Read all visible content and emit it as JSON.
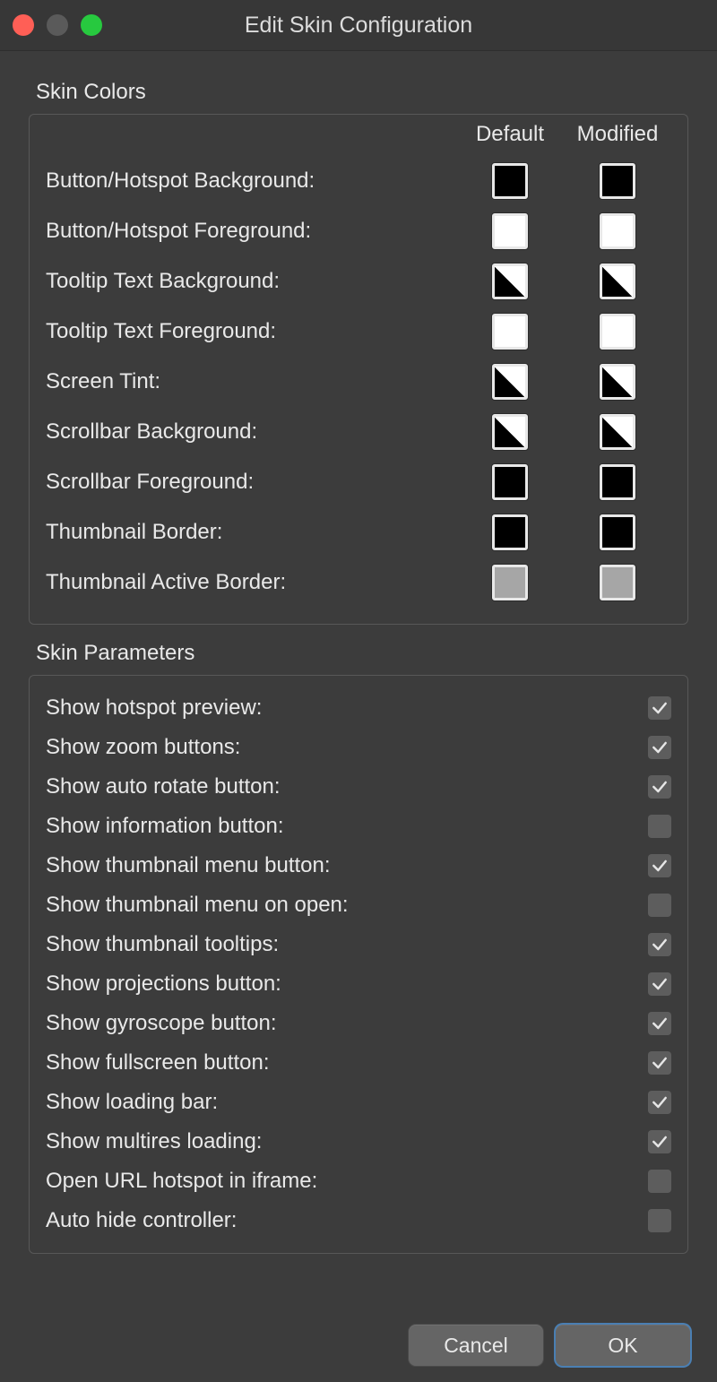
{
  "window": {
    "title": "Edit Skin Configuration"
  },
  "sections": {
    "colors_title": "Skin Colors",
    "params_title": "Skin Parameters"
  },
  "colors": {
    "header_default": "Default",
    "header_modified": "Modified",
    "rows": [
      {
        "label": "Button/Hotspot Background:",
        "default": "black",
        "modified": "black"
      },
      {
        "label": "Button/Hotspot Foreground:",
        "default": "white",
        "modified": "white"
      },
      {
        "label": "Tooltip Text Background:",
        "default": "diag",
        "modified": "diag"
      },
      {
        "label": "Tooltip Text Foreground:",
        "default": "white",
        "modified": "white"
      },
      {
        "label": "Screen Tint:",
        "default": "diag",
        "modified": "diag"
      },
      {
        "label": "Scrollbar Background:",
        "default": "diag",
        "modified": "diag"
      },
      {
        "label": "Scrollbar Foreground:",
        "default": "black",
        "modified": "black"
      },
      {
        "label": "Thumbnail Border:",
        "default": "black",
        "modified": "black"
      },
      {
        "label": "Thumbnail Active Border:",
        "default": "gray",
        "modified": "gray"
      }
    ]
  },
  "params": [
    {
      "label": "Show hotspot preview:",
      "checked": true
    },
    {
      "label": "Show zoom buttons:",
      "checked": true
    },
    {
      "label": "Show auto rotate button:",
      "checked": true
    },
    {
      "label": "Show information button:",
      "checked": false
    },
    {
      "label": "Show thumbnail menu button:",
      "checked": true
    },
    {
      "label": "Show thumbnail menu on open:",
      "checked": false
    },
    {
      "label": "Show thumbnail tooltips:",
      "checked": true
    },
    {
      "label": "Show projections button:",
      "checked": true
    },
    {
      "label": "Show gyroscope button:",
      "checked": true
    },
    {
      "label": "Show fullscreen button:",
      "checked": true
    },
    {
      "label": "Show loading bar:",
      "checked": true
    },
    {
      "label": "Show multires loading:",
      "checked": true
    },
    {
      "label": "Open URL hotspot in iframe:",
      "checked": false
    },
    {
      "label": "Auto hide controller:",
      "checked": false
    }
  ],
  "buttons": {
    "cancel": "Cancel",
    "ok": "OK"
  }
}
